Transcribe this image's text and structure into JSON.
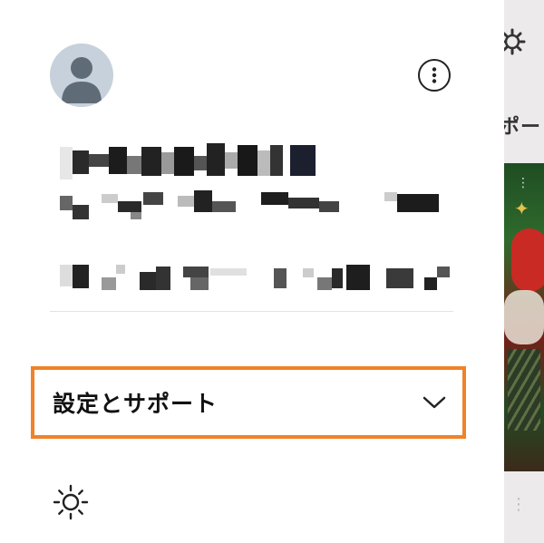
{
  "drawer": {
    "settings_label": "設定とサポート",
    "theme_icon": "sun-icon",
    "more_icon": "more-vertical-icon",
    "expand_icon": "chevron-down-icon",
    "avatar_icon": "default-avatar-icon"
  },
  "background_page": {
    "title_fragment": "ポー",
    "settings_icon": "gear-icon"
  },
  "colors": {
    "highlight": "#f08228",
    "avatar_bg": "#c7d1db",
    "avatar_fg": "#5f6c78"
  }
}
